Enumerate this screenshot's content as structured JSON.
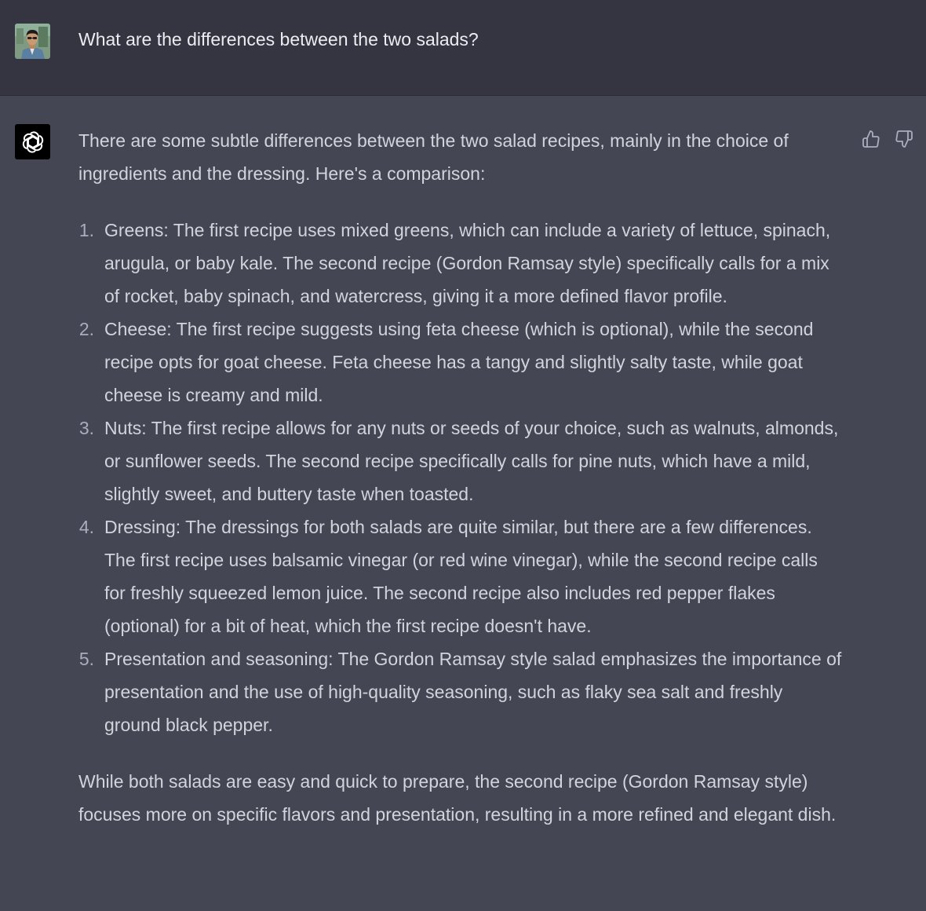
{
  "user_message": {
    "avatar_icon": "user-photo-avatar",
    "text": "What are the differences between the two salads?"
  },
  "assistant_message": {
    "logo_icon": "openai-logo-icon",
    "intro": "There are some subtle differences between the two salad recipes, mainly in the choice of ingredients and the dressing. Here's a comparison:",
    "items": [
      "Greens: The first recipe uses mixed greens, which can include a variety of lettuce, spinach, arugula, or baby kale. The second recipe (Gordon Ramsay style) specifically calls for a mix of rocket, baby spinach, and watercress, giving it a more defined flavor profile.",
      "Cheese: The first recipe suggests using feta cheese (which is optional), while the second recipe opts for goat cheese. Feta cheese has a tangy and slightly salty taste, while goat cheese is creamy and mild.",
      "Nuts: The first recipe allows for any nuts or seeds of your choice, such as walnuts, almonds, or sunflower seeds. The second recipe specifically calls for pine nuts, which have a mild, slightly sweet, and buttery taste when toasted.",
      "Dressing: The dressings for both salads are quite similar, but there are a few differences. The first recipe uses balsamic vinegar (or red wine vinegar), while the second recipe calls for freshly squeezed lemon juice. The second recipe also includes red pepper flakes (optional) for a bit of heat, which the first recipe doesn't have.",
      "Presentation and seasoning: The Gordon Ramsay style salad emphasizes the importance of presentation and the use of high-quality seasoning, such as flaky sea salt and freshly ground black pepper."
    ],
    "conclusion": "While both salads are easy and quick to prepare, the second recipe (Gordon Ramsay style) focuses more on specific flavors and presentation, resulting in a more refined and elegant dish.",
    "feedback": {
      "up_icon": "thumbs-up-icon",
      "down_icon": "thumbs-down-icon"
    }
  },
  "colors": {
    "user_bg": "#343541",
    "assistant_bg": "#444654",
    "text": "#d1d5db"
  }
}
